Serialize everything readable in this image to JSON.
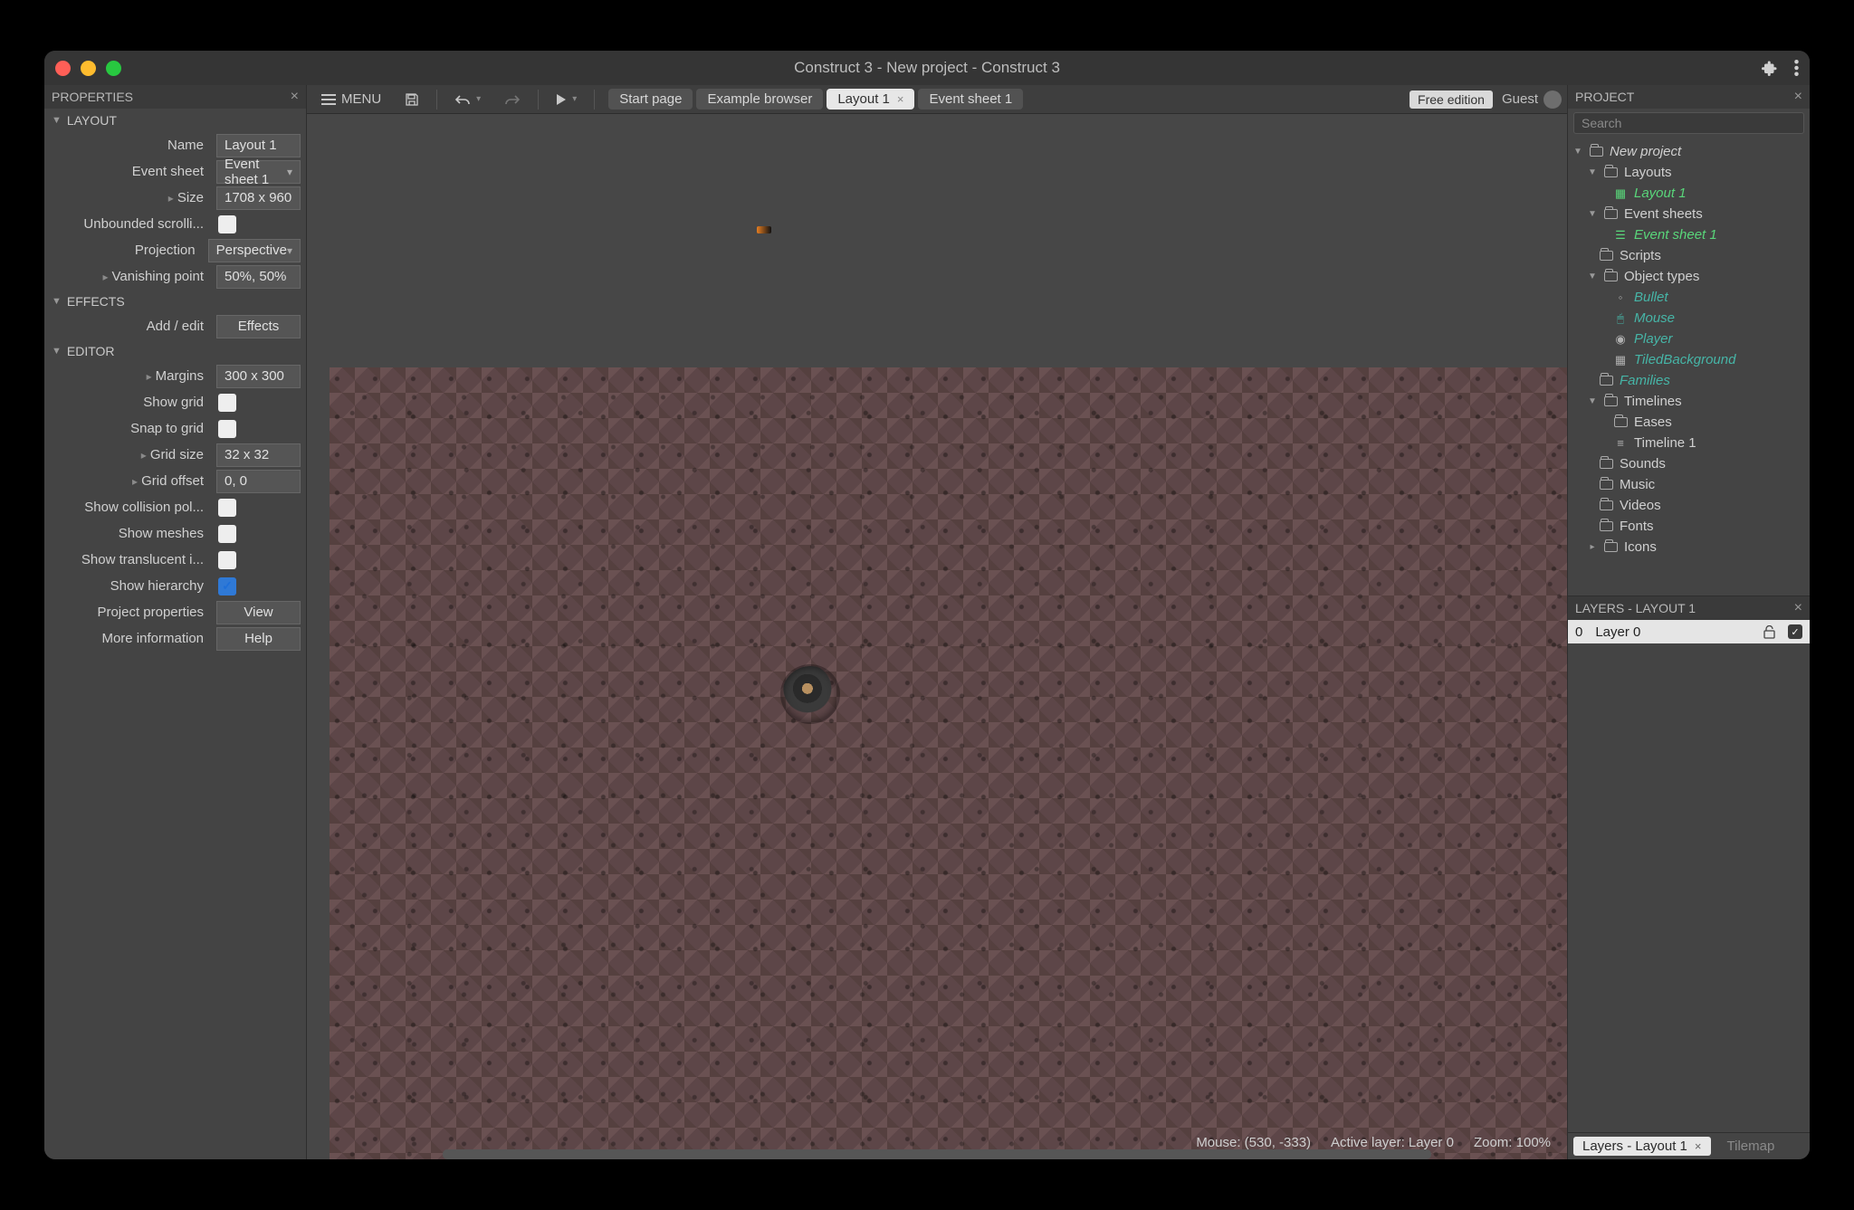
{
  "title": "Construct 3 - New project - Construct 3",
  "properties": {
    "header": "PROPERTIES",
    "sectLayout": "LAYOUT",
    "name_lbl": "Name",
    "name_val": "Layout 1",
    "evsheet_lbl": "Event sheet",
    "evsheet_val": "Event sheet 1",
    "size_lbl": "Size",
    "size_val": "1708 x 960",
    "unbound_lbl": "Unbounded scrolli...",
    "proj_lbl": "Projection",
    "proj_val": "Perspective",
    "vanish_lbl": "Vanishing point",
    "vanish_val": "50%, 50%",
    "sectEffects": "EFFECTS",
    "addedit_lbl": "Add / edit",
    "addedit_val": "Effects",
    "sectEditor": "EDITOR",
    "margins_lbl": "Margins",
    "margins_val": "300 x 300",
    "showgrid_lbl": "Show grid",
    "snapgrid_lbl": "Snap to grid",
    "gridsize_lbl": "Grid size",
    "gridsize_val": "32 x 32",
    "gridoff_lbl": "Grid offset",
    "gridoff_val": "0, 0",
    "showcol_lbl": "Show collision pol...",
    "showmesh_lbl": "Show meshes",
    "showtrans_lbl": "Show translucent i...",
    "showhier_lbl": "Show hierarchy",
    "projprop_lbl": "Project properties",
    "projprop_val": "View",
    "moreinfo_lbl": "More information",
    "moreinfo_val": "Help"
  },
  "toolbar": {
    "menu": "MENU",
    "tabs": {
      "start": "Start page",
      "example": "Example browser",
      "layout": "Layout 1",
      "evsheet": "Event sheet 1"
    },
    "free": "Free edition",
    "guest": "Guest"
  },
  "status": {
    "mouse": "Mouse: (530, -333)",
    "layer": "Active layer: Layer 0",
    "zoom": "Zoom: 100%"
  },
  "project": {
    "header": "PROJECT",
    "search": "Search",
    "root": "New project",
    "layouts": "Layouts",
    "layout1": "Layout 1",
    "evsheets": "Event sheets",
    "evsheet1": "Event sheet 1",
    "scripts": "Scripts",
    "objtypes": "Object types",
    "bullet": "Bullet",
    "mouse": "Mouse",
    "player": "Player",
    "tiled": "TiledBackground",
    "families": "Families",
    "timelines": "Timelines",
    "eases": "Eases",
    "timeline1": "Timeline 1",
    "sounds": "Sounds",
    "music": "Music",
    "videos": "Videos",
    "fonts": "Fonts",
    "icons": "Icons"
  },
  "layers": {
    "header": "LAYERS - LAYOUT 1",
    "index": "0",
    "name": "Layer 0",
    "tab": "Layers - Layout 1",
    "tilemap": "Tilemap"
  }
}
